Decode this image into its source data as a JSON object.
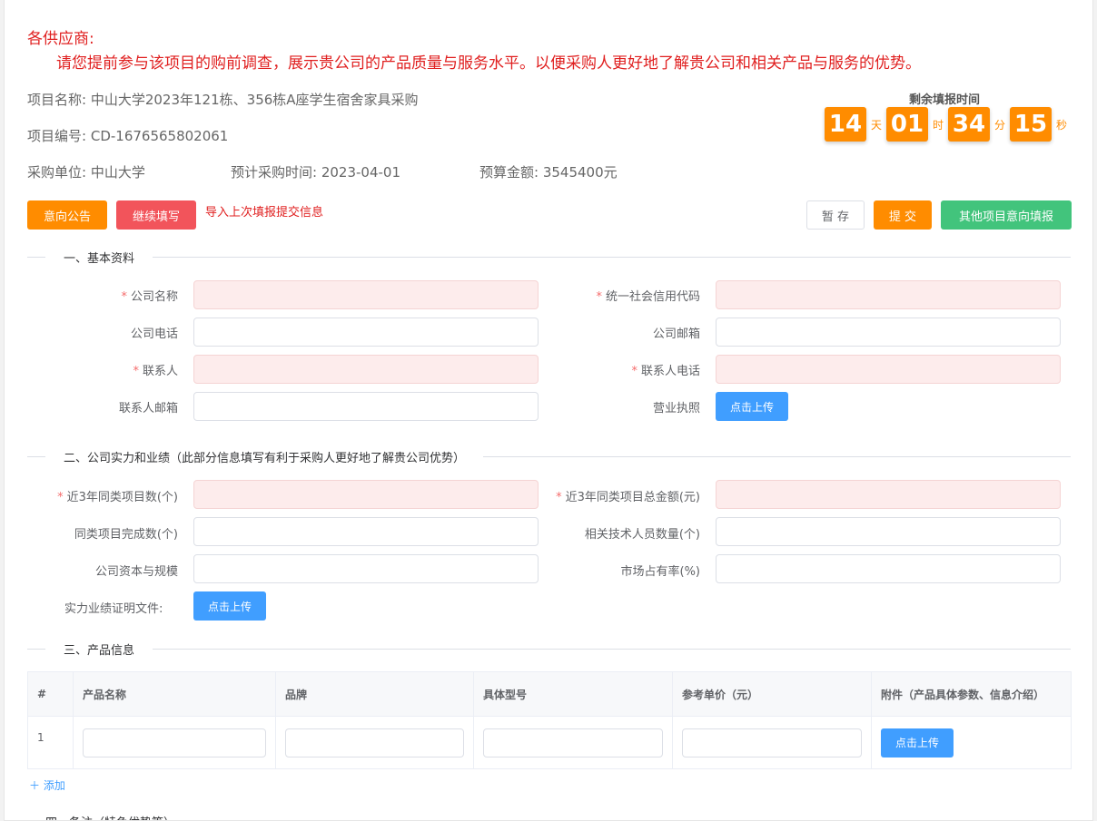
{
  "notice": {
    "title": "各供应商:",
    "body": "请您提前参与该项目的购前调查，展示贵公司的产品质量与服务水平。以便采购人更好地了解贵公司和相关产品与服务的优势。"
  },
  "project": {
    "name_label": "项目名称:",
    "name": "中山大学2023年121栋、356栋A座学生宿舍家具采购",
    "code_label": "项目编号:",
    "code": "CD-1676565802061",
    "buyer_label": "采购单位:",
    "buyer": "中山大学",
    "time_label": "预计采购时间:",
    "time": "2023-04-01",
    "budget_label": "预算金额:",
    "budget": "3545400元"
  },
  "timer": {
    "title": "剩余填报时间",
    "days": "14",
    "days_unit": "天",
    "hours": "01",
    "hours_unit": "时",
    "minutes": "34",
    "minutes_unit": "分",
    "seconds": "15",
    "seconds_unit": "秒"
  },
  "actions": {
    "notice_btn": "意向公告",
    "continue_btn": "继续填写",
    "import_link": "导入上次填报提交信息",
    "save_btn": "暂 存",
    "submit_btn": "提 交",
    "other_btn": "其他项目意向填报"
  },
  "section1": {
    "title": "一、基本资料",
    "company_name": "公司名称",
    "credit_code": "统一社会信用代码",
    "phone": "公司电话",
    "email": "公司邮箱",
    "contact": "联系人",
    "contact_phone": "联系人电话",
    "contact_email": "联系人邮箱",
    "license": "营业执照",
    "upload": "点击上传"
  },
  "section2": {
    "title": "二、公司实力和业绩（此部分信息填写有利于采购人更好地了解贵公司优势）",
    "projects_3y": "近3年同类项目数(个)",
    "amount_3y": "近3年同类项目总金额(元)",
    "completed": "同类项目完成数(个)",
    "tech_staff": "相关技术人员数量(个)",
    "capital": "公司资本与规模",
    "market_share": "市场占有率(%)",
    "proof": "实力业绩证明文件:",
    "upload": "点击上传"
  },
  "section3": {
    "title": "三、产品信息",
    "columns": [
      "#",
      "产品名称",
      "品牌",
      "具体型号",
      "参考单价（元）",
      "附件（产品具体参数、信息介绍）"
    ],
    "rows": [
      {
        "index": "1"
      }
    ],
    "upload": "点击上传",
    "add": "添加"
  },
  "section4": {
    "title": "四、备注（特色优势等）"
  },
  "colors": {
    "accent_orange": "#ff8c00",
    "notice_red": "#e02020",
    "upload_blue": "#409eff",
    "green": "#42c47c",
    "required_bg": "#fdecec"
  }
}
